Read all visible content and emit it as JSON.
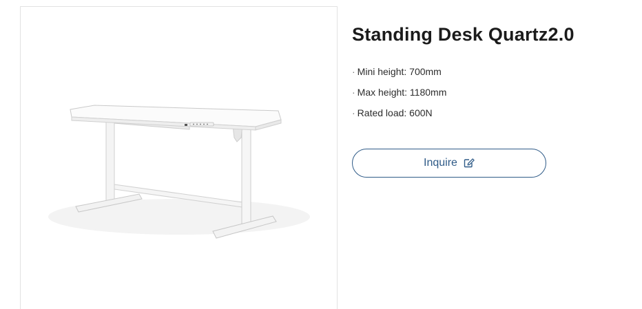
{
  "product": {
    "title": "Standing Desk Quartz2.0",
    "image_alt": "white standing desk",
    "specs": [
      {
        "bullet": "·",
        "text": "Mini height: 700mm"
      },
      {
        "bullet": "·",
        "text": "Max height: 1180mm"
      },
      {
        "bullet": "·",
        "text": "Rated load: 600N"
      }
    ]
  },
  "actions": {
    "inquire_label": "Inquire",
    "inquire_icon": "edit-icon"
  },
  "colors": {
    "accent": "#2e5a87",
    "title": "#1b1b1b",
    "text": "#2b2b2b",
    "border": "#e2e2e2"
  }
}
